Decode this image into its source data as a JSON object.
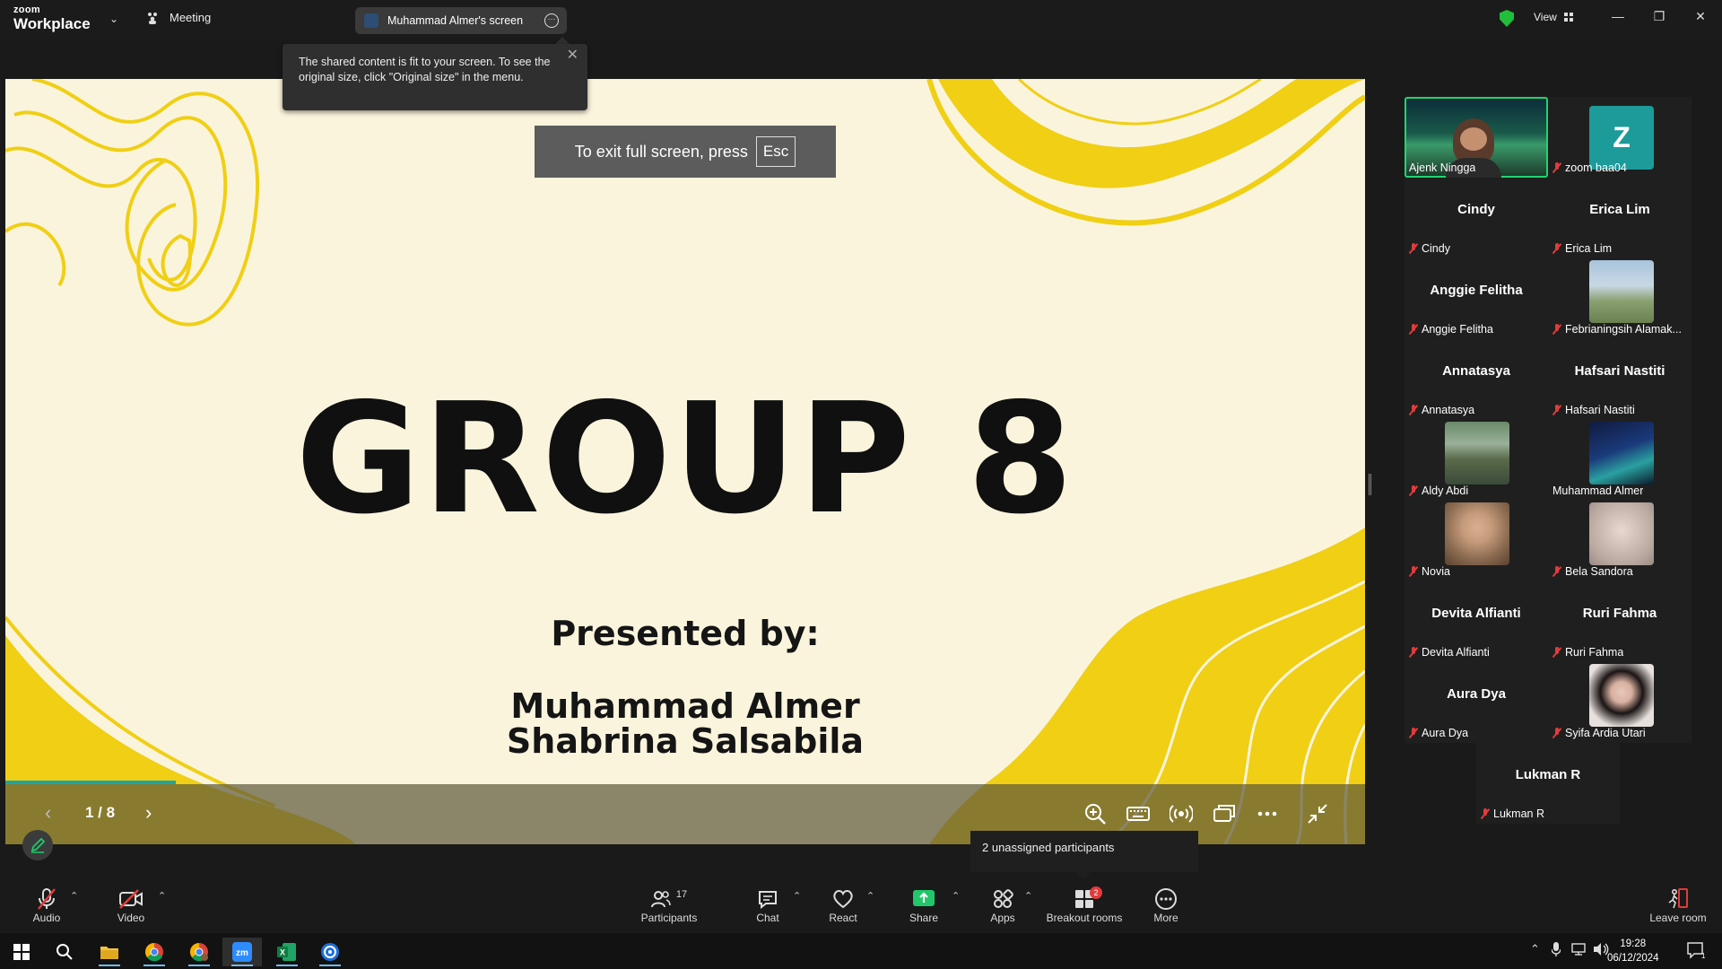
{
  "titlebar": {
    "logo_top": "zoom",
    "logo_bottom": "Workplace",
    "meeting_label": "Meeting",
    "screen_tab_label": "Muhammad Almer's screen",
    "view_label": "View"
  },
  "tooltip": {
    "text": "The shared content is fit to your screen. To see the original size, click \"Original size\" in the menu."
  },
  "slide": {
    "title": "GROUP 8",
    "presented_by": "Presented by:",
    "presenters": [
      "Muhammad Almer",
      "Shabrina Salsabila"
    ],
    "page_indicator": "1 / 8",
    "progress": 0.125,
    "esc_text": "To exit full screen, press",
    "esc_key": "Esc"
  },
  "gallery": {
    "tiles": [
      {
        "name": "Ajenk Ningga",
        "big": ""
      },
      {
        "name": "zoom baa04",
        "big": "",
        "avatar_letter": "Z"
      },
      {
        "name": "Cindy",
        "big": "Cindy"
      },
      {
        "name": "Erica Lim",
        "big": "Erica Lim"
      },
      {
        "name": "Anggie Felitha",
        "big": "Anggie Felitha"
      },
      {
        "name": "Febrianingsih Alamak...",
        "big": ""
      },
      {
        "name": "Annatasya",
        "big": "Annatasya"
      },
      {
        "name": "Hafsari Nastiti",
        "big": "Hafsari Nastiti"
      },
      {
        "name": "Aldy Abdi",
        "big": ""
      },
      {
        "name": "Muhammad Almer",
        "big": ""
      },
      {
        "name": "Novia",
        "big": ""
      },
      {
        "name": "Bela Sandora",
        "big": ""
      },
      {
        "name": "Devita Alfianti",
        "big": "Devita Alfianti"
      },
      {
        "name": "Ruri Fahma",
        "big": "Ruri Fahma"
      },
      {
        "name": "Aura Dya",
        "big": "Aura Dya"
      },
      {
        "name": "Syifa Ardia Utari",
        "big": ""
      },
      {
        "name": "Lukman R",
        "big": "Lukman R"
      }
    ],
    "unassigned": "2 unassigned participants"
  },
  "toolbar": {
    "audio": "Audio",
    "video": "Video",
    "participants": "Participants",
    "participants_count": "17",
    "chat": "Chat",
    "react": "React",
    "share": "Share",
    "apps": "Apps",
    "breakout": "Breakout rooms",
    "breakout_badge": "2",
    "more": "More",
    "leave": "Leave room"
  },
  "taskbar": {
    "time": "19:28",
    "date": "06/12/2024",
    "notif_count": "1"
  }
}
